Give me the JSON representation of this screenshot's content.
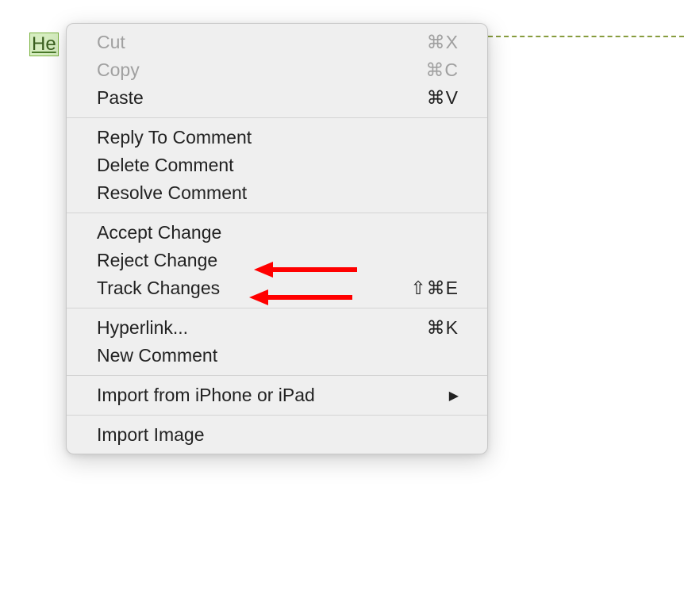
{
  "document": {
    "highlighted_text": "He"
  },
  "context_menu": {
    "sections": [
      {
        "items": [
          {
            "label": "Cut",
            "shortcut": "⌘X",
            "disabled": true
          },
          {
            "label": "Copy",
            "shortcut": "⌘C",
            "disabled": true
          },
          {
            "label": "Paste",
            "shortcut": "⌘V",
            "disabled": false
          }
        ]
      },
      {
        "items": [
          {
            "label": "Reply To Comment",
            "shortcut": "",
            "disabled": false
          },
          {
            "label": "Delete Comment",
            "shortcut": "",
            "disabled": false
          },
          {
            "label": "Resolve Comment",
            "shortcut": "",
            "disabled": false
          }
        ]
      },
      {
        "items": [
          {
            "label": "Accept Change",
            "shortcut": "",
            "disabled": false
          },
          {
            "label": "Reject Change",
            "shortcut": "",
            "disabled": false
          },
          {
            "label": "Track Changes",
            "shortcut": "⇧⌘E",
            "disabled": false
          }
        ]
      },
      {
        "items": [
          {
            "label": "Hyperlink...",
            "shortcut": "⌘K",
            "disabled": false
          },
          {
            "label": "New Comment",
            "shortcut": "",
            "disabled": false
          }
        ]
      },
      {
        "items": [
          {
            "label": "Import from iPhone or iPad",
            "shortcut": "",
            "disabled": false,
            "submenu": true
          }
        ]
      },
      {
        "items": [
          {
            "label": "Import Image",
            "shortcut": "",
            "disabled": false
          }
        ]
      }
    ]
  }
}
